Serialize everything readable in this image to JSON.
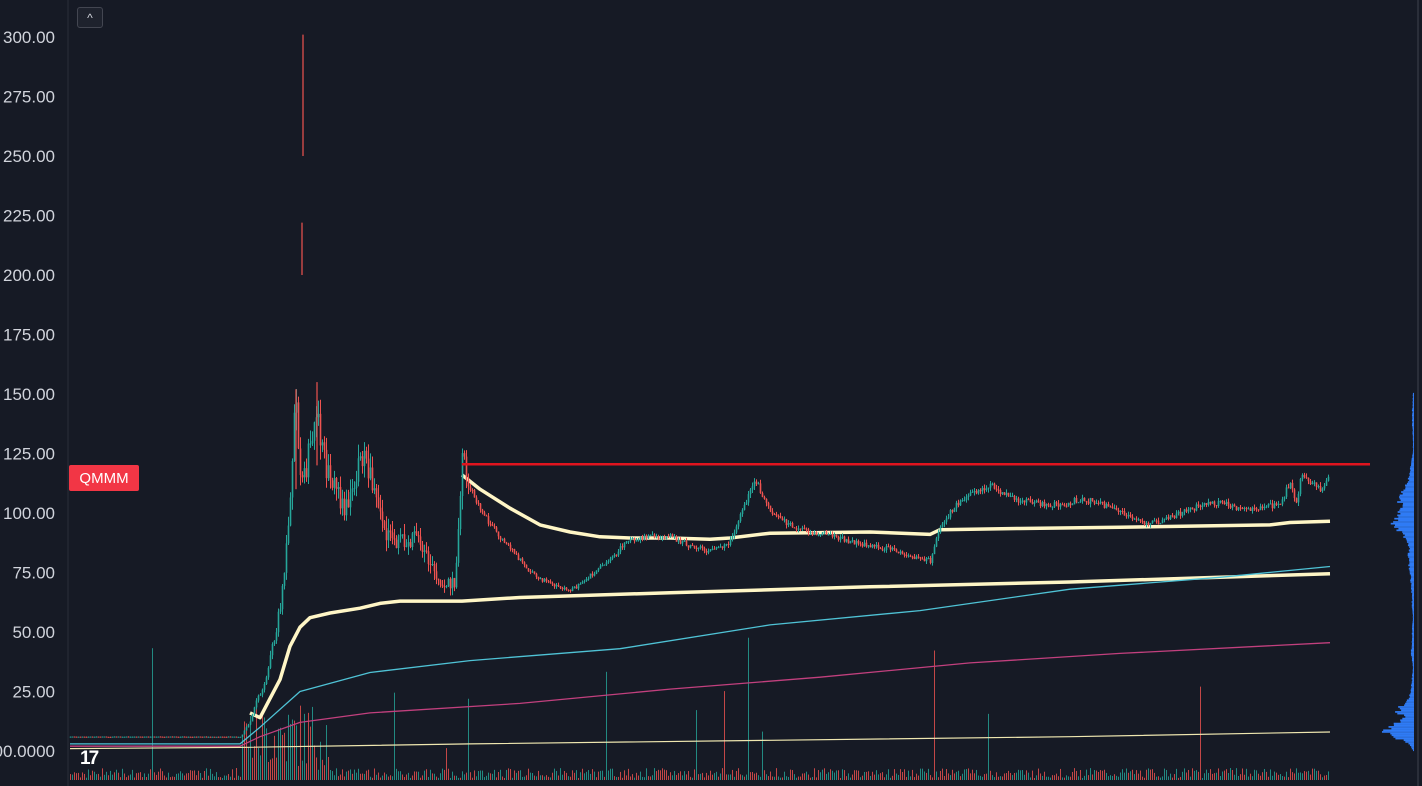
{
  "symbol": "QMMM",
  "ui": {
    "collapse_glyph": "^",
    "logo_text": "17",
    "logo_icon": "tradingview-logo-icon"
  },
  "colors": {
    "background": "#161a25",
    "grid": "#202430",
    "up": "#26a69a",
    "down": "#ef5350",
    "resistance": "#e0141e",
    "avwap": "#fff6c6",
    "ma_cyan": "#4fc3d6",
    "ma_pink": "#c2407e",
    "ma_light": "#efe7b0",
    "volume_profile": "#2f7bf5",
    "badge": "#f23645"
  },
  "chart_data": {
    "type": "candlestick",
    "title": "",
    "xlabel": "",
    "ylabel": "",
    "ylim": [
      -0.5,
      310
    ],
    "y_tick_labels": [
      "00.0000",
      "25.00",
      "50.00",
      "75.00",
      "100.00",
      "125.00",
      "150.00",
      "175.00",
      "200.00",
      "225.00",
      "250.00",
      "275.00",
      "300.00"
    ],
    "y_tick_values": [
      0,
      25,
      50,
      75,
      100,
      125,
      150,
      175,
      200,
      225,
      250,
      275,
      300
    ],
    "bar_count": 1260,
    "grid": false,
    "price_path": [
      [
        0,
        6
      ],
      [
        170,
        6
      ],
      [
        175,
        9
      ],
      [
        180,
        12
      ],
      [
        185,
        20
      ],
      [
        195,
        28
      ],
      [
        205,
        50
      ],
      [
        210,
        60
      ],
      [
        215,
        80
      ],
      [
        220,
        110
      ],
      [
        225,
        150
      ],
      [
        230,
        120
      ],
      [
        235,
        115
      ],
      [
        245,
        145
      ],
      [
        255,
        120
      ],
      [
        265,
        110
      ],
      [
        275,
        100
      ],
      [
        285,
        115
      ],
      [
        295,
        125
      ],
      [
        305,
        105
      ],
      [
        315,
        90
      ],
      [
        330,
        88
      ],
      [
        345,
        90
      ],
      [
        360,
        80
      ],
      [
        372,
        68
      ],
      [
        385,
        72
      ],
      [
        392,
        122
      ],
      [
        400,
        110
      ],
      [
        420,
        95
      ],
      [
        440,
        85
      ],
      [
        460,
        75
      ],
      [
        480,
        70
      ],
      [
        500,
        67
      ],
      [
        520,
        74
      ],
      [
        540,
        80
      ],
      [
        555,
        88
      ],
      [
        575,
        90
      ],
      [
        600,
        90
      ],
      [
        620,
        86
      ],
      [
        640,
        84
      ],
      [
        660,
        88
      ],
      [
        670,
        100
      ],
      [
        685,
        114
      ],
      [
        700,
        100
      ],
      [
        720,
        95
      ],
      [
        740,
        92
      ],
      [
        760,
        91
      ],
      [
        780,
        88
      ],
      [
        800,
        86
      ],
      [
        820,
        85
      ],
      [
        840,
        82
      ],
      [
        860,
        80
      ],
      [
        870,
        95
      ],
      [
        890,
        105
      ],
      [
        920,
        112
      ],
      [
        935,
        108
      ],
      [
        950,
        105
      ],
      [
        970,
        104
      ],
      [
        990,
        103
      ],
      [
        1010,
        106
      ],
      [
        1030,
        104
      ],
      [
        1050,
        101
      ],
      [
        1070,
        96
      ],
      [
        1090,
        96
      ],
      [
        1110,
        100
      ],
      [
        1130,
        103
      ],
      [
        1150,
        104
      ],
      [
        1170,
        102
      ],
      [
        1190,
        102
      ],
      [
        1210,
        104
      ],
      [
        1220,
        113
      ],
      [
        1225,
        103
      ],
      [
        1232,
        117
      ],
      [
        1240,
        113
      ],
      [
        1250,
        110
      ],
      [
        1260,
        116
      ]
    ],
    "spike_wicks": [
      {
        "bar": 233,
        "high": 301,
        "low": 250
      },
      {
        "bar": 232,
        "high": 222,
        "low": 200
      },
      {
        "bar": 226,
        "high": 152,
        "low": 110
      },
      {
        "bar": 247,
        "high": 155,
        "low": 120
      }
    ],
    "resistance": {
      "value": 120.5,
      "from_bar": 392,
      "to_bar": 1300
    },
    "series": [
      {
        "values": [
          [
            180,
            16
          ],
          [
            190,
            14
          ],
          [
            200,
            22
          ],
          [
            210,
            30
          ],
          [
            220,
            44
          ],
          [
            230,
            52
          ],
          [
            240,
            56
          ],
          [
            260,
            58
          ],
          [
            290,
            60
          ],
          [
            310,
            62
          ],
          [
            330,
            63
          ],
          [
            392,
            63
          ],
          [
            450,
            64.5
          ],
          [
            600,
            66.5
          ],
          [
            800,
            69
          ],
          [
            1000,
            71
          ],
          [
            1150,
            73
          ],
          [
            1260,
            74.5
          ]
        ]
      },
      {
        "values": [
          [
            392,
            116
          ],
          [
            410,
            110
          ],
          [
            440,
            102
          ],
          [
            470,
            95
          ],
          [
            500,
            92
          ],
          [
            530,
            90
          ],
          [
            560,
            89.5
          ],
          [
            600,
            89.5
          ],
          [
            640,
            89
          ],
          [
            660,
            89.5
          ],
          [
            700,
            91.5
          ],
          [
            800,
            92
          ],
          [
            860,
            91
          ],
          [
            870,
            93
          ],
          [
            950,
            93.5
          ],
          [
            1050,
            94
          ],
          [
            1200,
            95
          ],
          [
            1220,
            96
          ],
          [
            1260,
            96.5
          ]
        ]
      },
      {
        "values": [
          [
            0,
            3
          ],
          [
            170,
            3
          ],
          [
            190,
            10
          ],
          [
            230,
            25
          ],
          [
            300,
            33
          ],
          [
            400,
            38
          ],
          [
            550,
            43
          ],
          [
            700,
            53
          ],
          [
            850,
            59
          ],
          [
            1000,
            68
          ],
          [
            1150,
            73
          ],
          [
            1260,
            77.5
          ]
        ]
      },
      {
        "values": [
          [
            0,
            2
          ],
          [
            170,
            2
          ],
          [
            190,
            6
          ],
          [
            230,
            12
          ],
          [
            300,
            16
          ],
          [
            450,
            20
          ],
          [
            600,
            26
          ],
          [
            750,
            31
          ],
          [
            900,
            37
          ],
          [
            1050,
            41
          ],
          [
            1260,
            45.5
          ]
        ]
      },
      {
        "values": [
          [
            0,
            1
          ],
          [
            170,
            1.5
          ],
          [
            400,
            3
          ],
          [
            700,
            4.5
          ],
          [
            1000,
            6
          ],
          [
            1260,
            8
          ]
        ]
      }
    ],
    "volume_profile": [
      [
        0,
        1
      ],
      [
        3,
        6
      ],
      [
        6,
        22
      ],
      [
        8,
        30
      ],
      [
        10,
        25
      ],
      [
        12,
        15
      ],
      [
        14,
        10
      ],
      [
        16,
        16
      ],
      [
        18,
        14
      ],
      [
        20,
        8
      ],
      [
        23,
        4
      ],
      [
        26,
        3
      ],
      [
        30,
        2
      ],
      [
        35,
        1
      ],
      [
        40,
        3
      ],
      [
        45,
        2
      ],
      [
        50,
        2
      ],
      [
        55,
        1
      ],
      [
        60,
        2
      ],
      [
        65,
        2
      ],
      [
        70,
        3
      ],
      [
        75,
        4
      ],
      [
        80,
        6
      ],
      [
        85,
        5
      ],
      [
        90,
        10
      ],
      [
        95,
        24
      ],
      [
        98,
        16
      ],
      [
        100,
        14
      ],
      [
        103,
        12
      ],
      [
        106,
        18
      ],
      [
        110,
        9
      ],
      [
        113,
        6
      ],
      [
        116,
        4
      ],
      [
        120,
        3
      ],
      [
        125,
        1
      ],
      [
        130,
        1
      ],
      [
        140,
        2
      ],
      [
        150,
        1
      ]
    ]
  }
}
